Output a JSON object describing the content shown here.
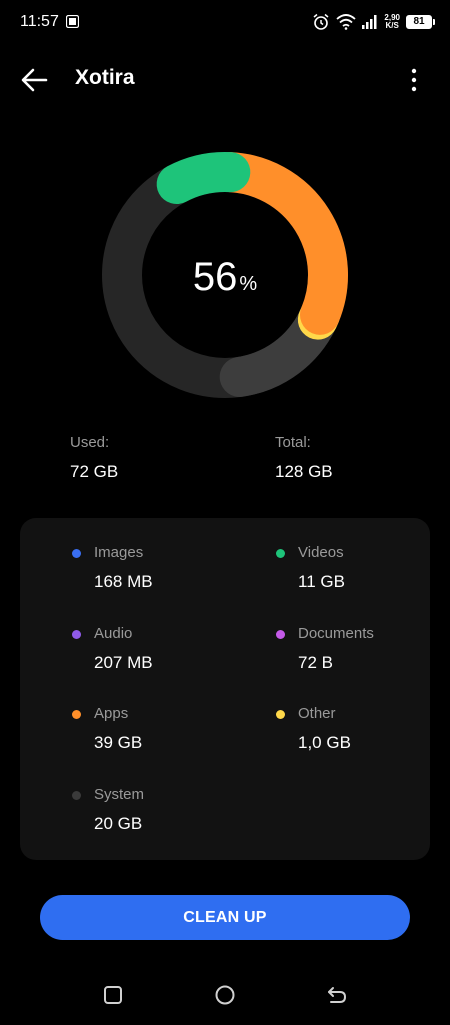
{
  "status_bar": {
    "time": "11:57",
    "net_speed_value": "2,90",
    "net_speed_unit": "K/S",
    "battery": "81"
  },
  "app_bar": {
    "title": "Xotira"
  },
  "storage": {
    "percent_used": "56",
    "percent_sign": "%",
    "used_label": "Used:",
    "used_value": "72 GB",
    "total_label": "Total:",
    "total_value": "128 GB",
    "donut_segments": [
      {
        "name": "Videos",
        "percent": 8.6,
        "color": "#1ec47a"
      },
      {
        "name": "Apps",
        "percent": 30.5,
        "color": "#ff8f2a"
      },
      {
        "name": "Other",
        "percent": 0.8,
        "color": "#ffd84a"
      },
      {
        "name": "System",
        "percent": 15.6,
        "color": "#3d3d3d"
      }
    ],
    "track_color": "#262626"
  },
  "categories": [
    {
      "label": "Images",
      "value": "168 MB",
      "color": "#3a6ff2"
    },
    {
      "label": "Videos",
      "value": "11 GB",
      "color": "#1ec47a"
    },
    {
      "label": "Audio",
      "value": "207 MB",
      "color": "#8f5ae8"
    },
    {
      "label": "Documents",
      "value": "72 B",
      "color": "#c45ae8"
    },
    {
      "label": "Apps",
      "value": "39 GB",
      "color": "#ff8f2a"
    },
    {
      "label": "Other",
      "value": "1,0 GB",
      "color": "#ffd84a"
    },
    {
      "label": "System",
      "value": "20 GB",
      "color": "#3a3a3a"
    }
  ],
  "actions": {
    "clean_up_label": "CLEAN UP"
  },
  "icons": {
    "back": "arrow-left-icon",
    "more": "more-vertical-icon",
    "recents": "square-icon",
    "home": "circle-icon",
    "back_nav": "return-icon"
  },
  "colors": {
    "accent": "#2f6ef1",
    "background": "#000000",
    "card": "#121212"
  }
}
